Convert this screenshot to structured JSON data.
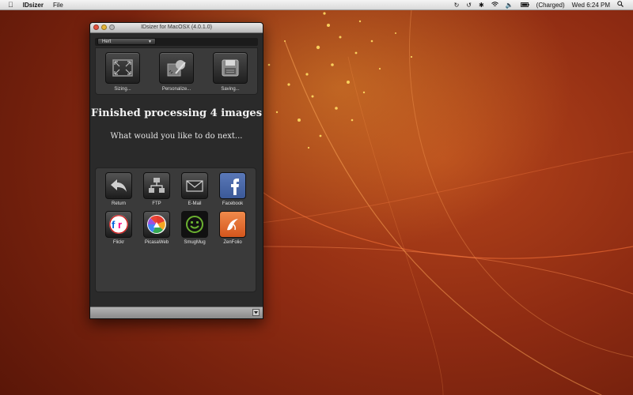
{
  "menubar": {
    "app_name": "IDsizer",
    "menus": [
      "File"
    ],
    "battery_status": "(Charged)",
    "clock": "Wed 6:24 PM"
  },
  "window": {
    "title": "IDsizer for MacOSX (4.0.1.0)",
    "preset_value": "Hert",
    "tools": [
      {
        "label": "Sizing...",
        "icon": "resize-icon"
      },
      {
        "label": "Personalize...",
        "icon": "personalize-icon"
      },
      {
        "label": "Saving...",
        "icon": "save-disk-icon"
      }
    ],
    "headline": "Finished processing 4 images",
    "subline": "What would you like to do next...",
    "actions": [
      {
        "label": "Return",
        "icon": "return-arrow-icon"
      },
      {
        "label": "FTP",
        "icon": "ftp-network-icon"
      },
      {
        "label": "E-Mail",
        "icon": "email-envelope-icon"
      },
      {
        "label": "Facebook",
        "icon": "facebook-icon"
      },
      {
        "label": "Flickr",
        "icon": "flickr-icon"
      },
      {
        "label": "PicasaWeb",
        "icon": "picasaweb-icon"
      },
      {
        "label": "SmugMug",
        "icon": "smugmug-icon"
      },
      {
        "label": "ZenFolio",
        "icon": "zenfolio-icon"
      }
    ]
  },
  "colors": {
    "facebook": "#3b5998",
    "flickr_blue": "#0063dc",
    "flickr_pink": "#ff0084",
    "smugmug_green": "#6bb130",
    "zenfolio_orange": "#e0662a"
  }
}
